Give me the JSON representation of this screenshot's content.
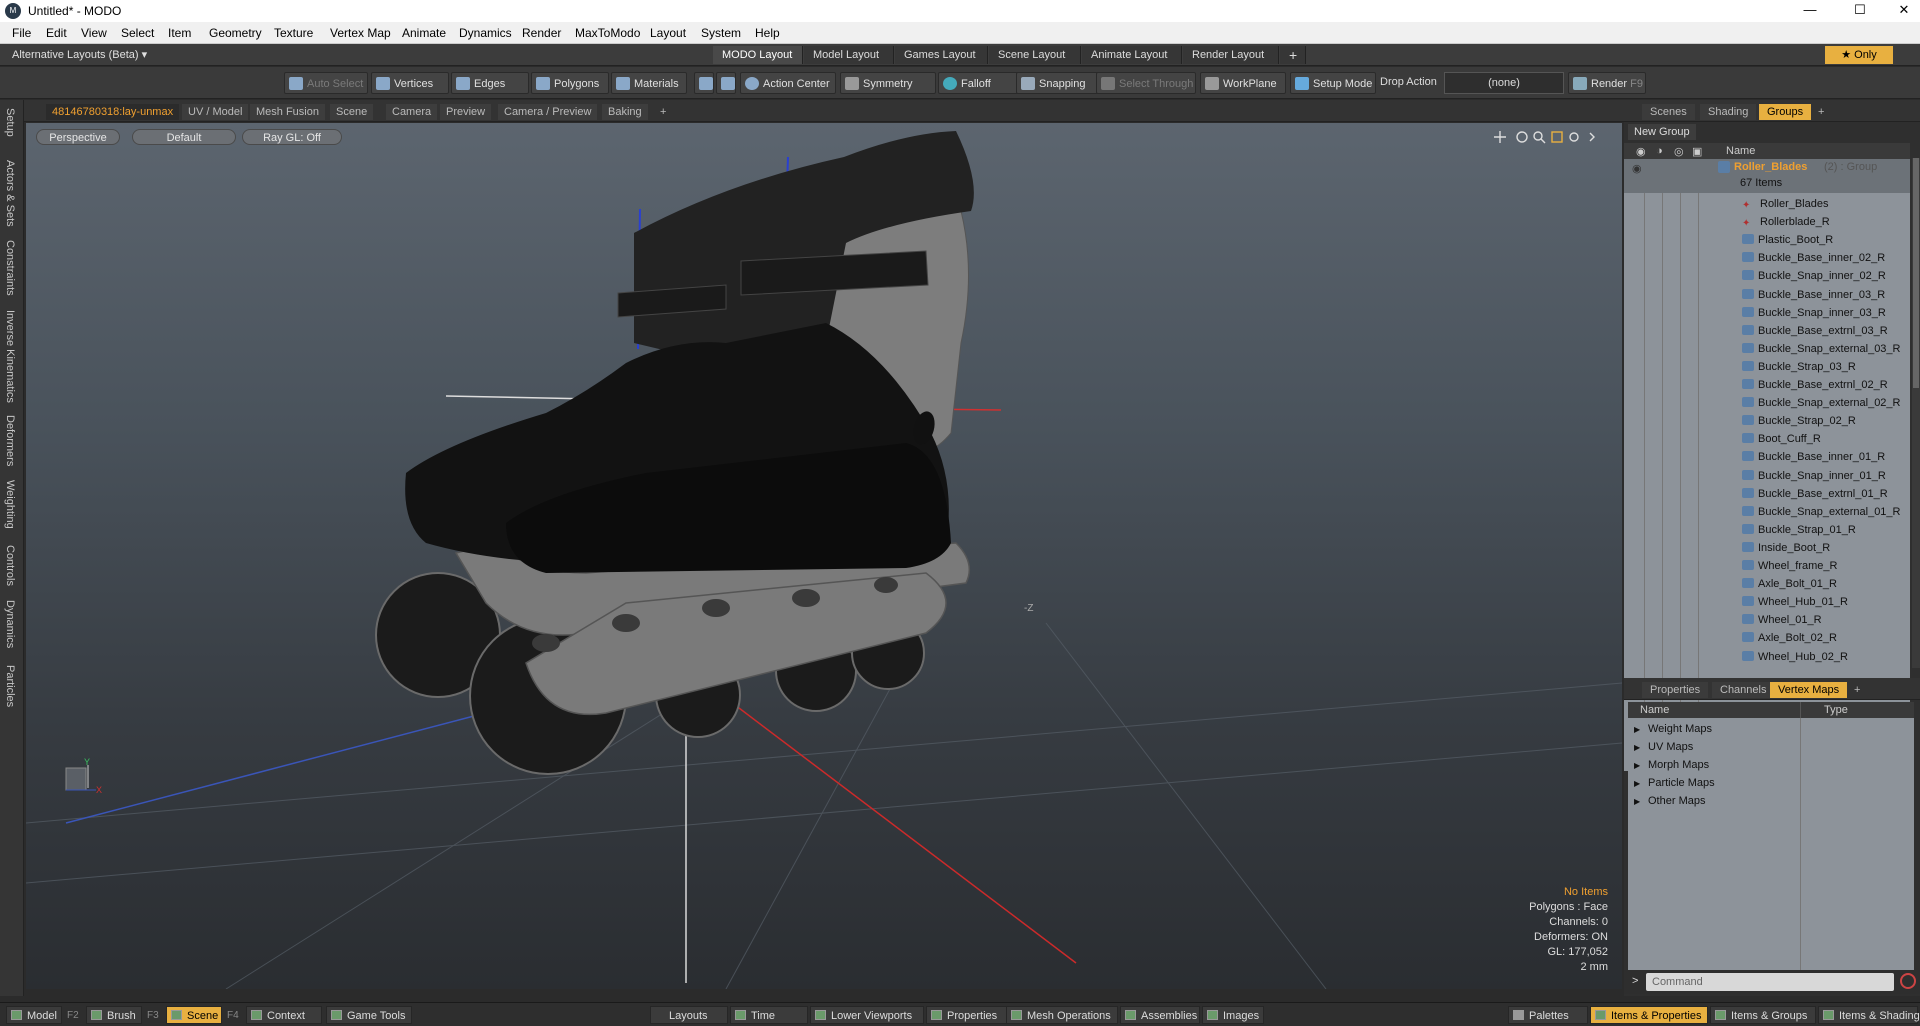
{
  "window": {
    "title": "Untitled* - MODO",
    "logo": "M",
    "controls": [
      "—",
      "☐",
      "✕"
    ]
  },
  "menu": [
    "File",
    "Edit",
    "View",
    "Select",
    "Item",
    "Geometry",
    "Texture",
    "Vertex Map",
    "Animate",
    "Dynamics",
    "Render",
    "MaxToModo",
    "Layout",
    "System",
    "Help"
  ],
  "layoutbar": {
    "alt_label": "Alternative Layouts (Beta) ▾",
    "tabs": [
      "MODO Layout",
      "Model Layout",
      "Games Layout",
      "Scene Layout",
      "Animate Layout",
      "Render Layout"
    ],
    "active_tab": "MODO Layout",
    "add": "+",
    "only_label": "★ Only"
  },
  "toolbar": {
    "auto_select": "Auto Select",
    "vertices": "Vertices",
    "edges": "Edges",
    "polygons": "Polygons",
    "materials": "Materials",
    "action_center": "Action Center",
    "symmetry": "Symmetry",
    "falloff": "Falloff",
    "snapping": "Snapping",
    "select_through": "Select Through",
    "workplane": "WorkPlane",
    "setup_mode": "Setup Mode",
    "drop_action": "Drop Action",
    "drop_value": "(none)",
    "render": "Render",
    "render_key": "F9"
  },
  "left_rail": [
    "Setup",
    "Actors & Sets",
    "Constraints",
    "Inverse Kinematics",
    "Deformers",
    "Weighting",
    "Controls",
    "Dynamics",
    "Particles"
  ],
  "viewport_tabs": [
    "48146780318:lay-unmax",
    "UV / Model",
    "Mesh Fusion",
    "Scene",
    "Camera",
    "Preview",
    "Camera / Preview",
    "Baking",
    "+"
  ],
  "viewport": {
    "view": "Perspective",
    "shading": "Default",
    "raygl": "Ray GL: Off",
    "axis_neg_z": "-Z",
    "axis_y": "Y",
    "axis_x": "X",
    "info": {
      "items": "No Items",
      "polygons": "Polygons : Face",
      "channels": "Channels: 0",
      "deformers": "Deformers: ON",
      "gl": "GL: 177,052",
      "unit": "2 mm"
    }
  },
  "right_tabs": [
    "Scenes",
    "Shading",
    "Groups",
    "+"
  ],
  "right_active": "Groups",
  "groups": {
    "new_group": "New Group",
    "name_header": "Name",
    "group_name": "Roller_Blades",
    "group_suffix": "(2) : Group",
    "group_count": "67 Items",
    "items": [
      "Roller_Blades",
      "Rollerblade_R",
      "Plastic_Boot_R",
      "Buckle_Base_inner_02_R",
      "Buckle_Snap_inner_02_R",
      "Buckle_Base_inner_03_R",
      "Buckle_Snap_inner_03_R",
      "Buckle_Base_extrnl_03_R",
      "Buckle_Snap_external_03_R",
      "Buckle_Strap_03_R",
      "Buckle_Base_extrnl_02_R",
      "Buckle_Snap_external_02_R",
      "Buckle_Strap_02_R",
      "Boot_Cuff_R",
      "Buckle_Base_inner_01_R",
      "Buckle_Snap_inner_01_R",
      "Buckle_Base_extrnl_01_R",
      "Buckle_Snap_external_01_R",
      "Buckle_Strap_01_R",
      "Inside_Boot_R",
      "Wheel_frame_R",
      "Axle_Bolt_01_R",
      "Wheel_Hub_01_R",
      "Wheel_01_R",
      "Axle_Bolt_02_R",
      "Wheel_Hub_02_R"
    ]
  },
  "prop_tabs": [
    "Properties",
    "Channels",
    "Vertex Maps",
    "+"
  ],
  "prop_active": "Vertex Maps",
  "vertex_maps": {
    "name_header": "Name",
    "type_header": "Type",
    "items": [
      "Weight Maps",
      "UV Maps",
      "Morph Maps",
      "Particle Maps",
      "Other Maps"
    ]
  },
  "command": {
    "prompt": ">",
    "placeholder": "Command"
  },
  "statusbar": {
    "left": [
      {
        "label": "Model",
        "key": "F2"
      },
      {
        "label": "Brush",
        "key": "F3"
      },
      {
        "label": "Scene",
        "key": "F4"
      },
      {
        "label": "Context",
        "key": ""
      },
      {
        "label": "Game Tools",
        "key": ""
      }
    ],
    "center": [
      "Layouts",
      "Time",
      "Lower Viewports",
      "Properties",
      "Mesh Operations",
      "Assemblies",
      "Images"
    ],
    "right": [
      "Palettes",
      "Items & Properties",
      "Items & Groups",
      "Items & Shading"
    ]
  },
  "colors": {
    "accent": "#e8b040",
    "panel": "#2f2f2f",
    "list_bg": "#8d939a"
  }
}
